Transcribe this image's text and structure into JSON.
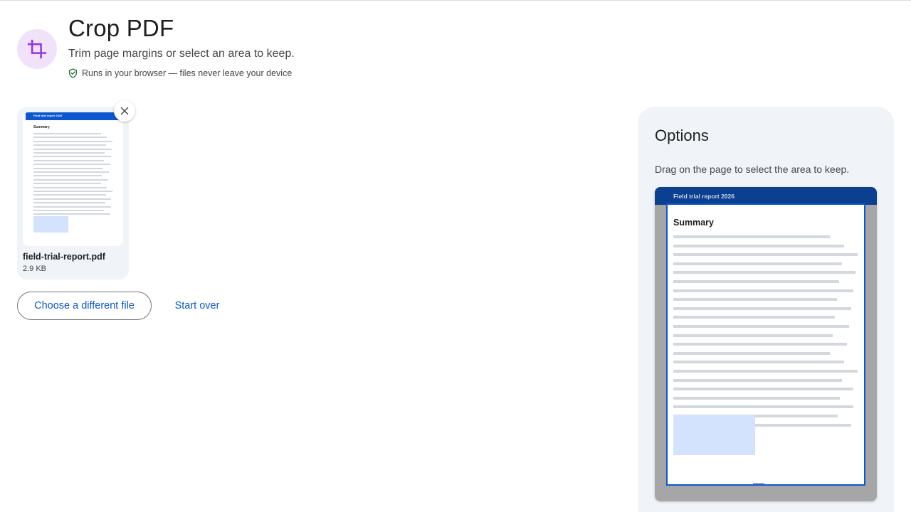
{
  "header": {
    "title": "Crop PDF",
    "subtitle": "Trim page margins or select an area to keep.",
    "privacy_note": "Runs in your browser — files never leave your device",
    "tool_icon": "crop-icon",
    "privacy_icon": "shield-check-icon"
  },
  "file": {
    "name": "field-trial-report.pdf",
    "size": "2.9 KB",
    "remove_icon": "close-icon",
    "thumbnail": {
      "header_text": "Field trial report 2026",
      "heading": "Summary"
    }
  },
  "actions": {
    "choose_label": "Choose a different file",
    "start_over_label": "Start over"
  },
  "options": {
    "title": "Options",
    "hint": "Drag on the page to select the area to keep.",
    "preview": {
      "header_text": "Field trial report 2026",
      "heading": "Summary"
    }
  },
  "colors": {
    "accent": "#0b57d0",
    "tool_icon_bg": "#f1e2fb",
    "tool_icon_fg": "#9334e6",
    "panel_bg": "#f0f4f9",
    "preview_header": "#0b3f8f"
  }
}
